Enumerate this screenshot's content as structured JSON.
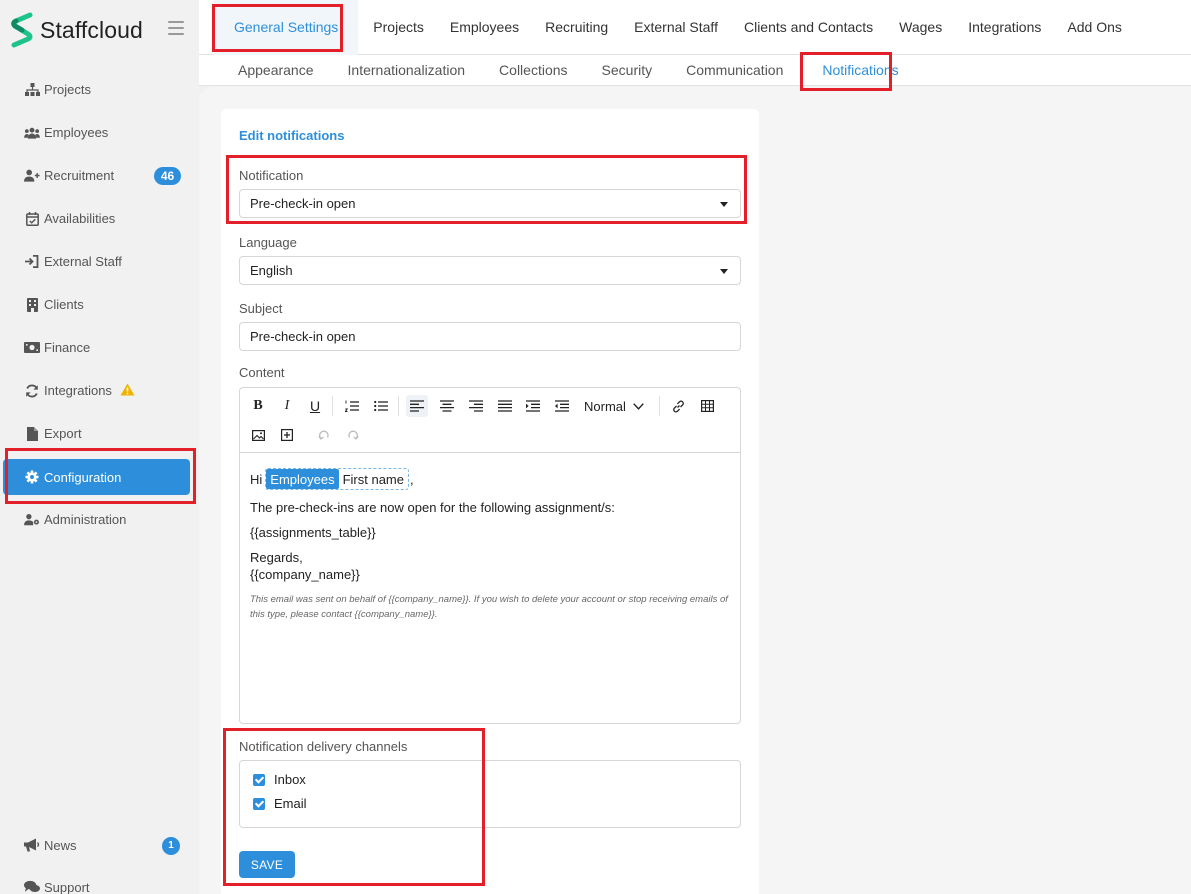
{
  "app": {
    "name": "Staffcloud"
  },
  "sidebar": {
    "items": [
      {
        "id": "projects",
        "label": "Projects",
        "icon": "sitemap-icon"
      },
      {
        "id": "employees",
        "label": "Employees",
        "icon": "users-icon"
      },
      {
        "id": "recruitment",
        "label": "Recruitment",
        "icon": "user-plus-icon",
        "badge": "46"
      },
      {
        "id": "availabilities",
        "label": "Availabilities",
        "icon": "calendar-check-icon"
      },
      {
        "id": "external-staff",
        "label": "External Staff",
        "icon": "sign-in-icon"
      },
      {
        "id": "clients",
        "label": "Clients",
        "icon": "building-icon"
      },
      {
        "id": "finance",
        "label": "Finance",
        "icon": "money-bill-icon"
      },
      {
        "id": "integrations",
        "label": "Integrations",
        "icon": "sync-icon",
        "warning": true
      },
      {
        "id": "export",
        "label": "Export",
        "icon": "file-icon"
      },
      {
        "id": "configuration",
        "label": "Configuration",
        "icon": "cog-icon",
        "active": true
      },
      {
        "id": "administration",
        "label": "Administration",
        "icon": "user-cog-icon"
      }
    ],
    "bottom": [
      {
        "id": "news",
        "label": "News",
        "icon": "megaphone-icon",
        "badge": "1"
      },
      {
        "id": "support",
        "label": "Support",
        "icon": "comments-icon"
      }
    ]
  },
  "topnav": {
    "tabs": [
      "General Settings",
      "Projects",
      "Employees",
      "Recruiting",
      "External Staff",
      "Clients and Contacts",
      "Wages",
      "Integrations",
      "Add Ons"
    ],
    "active": "General Settings"
  },
  "subnav": {
    "tabs": [
      "Appearance",
      "Internationalization",
      "Collections",
      "Security",
      "Communication",
      "Notifications"
    ],
    "active": "Notifications"
  },
  "form": {
    "title": "Edit notifications",
    "notification": {
      "label": "Notification",
      "value": "Pre-check-in open"
    },
    "language": {
      "label": "Language",
      "value": "English"
    },
    "subject": {
      "label": "Subject",
      "value": "Pre-check-in open"
    },
    "content": {
      "label": "Content",
      "toolbar": {
        "format_select": "Normal"
      },
      "body": {
        "greeting": "Hi",
        "chip_entity": "Employees",
        "chip_field": "First name",
        "greeting_suffix": ",",
        "line1": "The pre-check-ins are now open for the following assignment/s:",
        "line2": "{{assignments_table}}",
        "line3": "Regards,",
        "line4": "{{company_name}}",
        "footnote": "This email was sent on behalf of {{company_name}}. If you wish to delete your account or stop receiving emails of this type, please contact {{company_name}}."
      }
    },
    "channels": {
      "label": "Notification delivery channels",
      "options": [
        {
          "label": "Inbox",
          "checked": true
        },
        {
          "label": "Email",
          "checked": true
        }
      ]
    },
    "save_label": "SAVE"
  },
  "colors": {
    "accent": "#2d8fdb",
    "highlight": "#e3202a",
    "warning": "#f0b400"
  }
}
